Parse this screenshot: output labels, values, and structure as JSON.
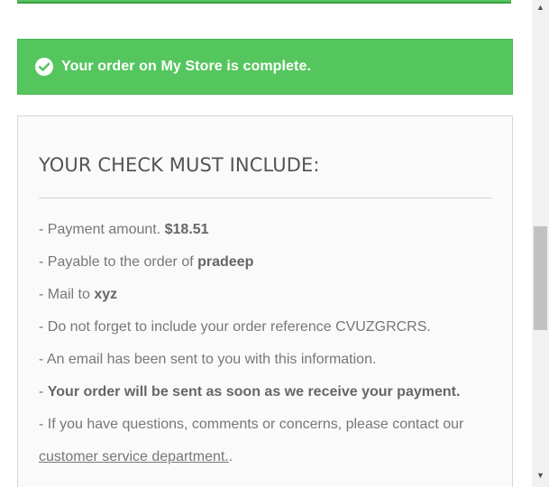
{
  "alert": {
    "message": "Your order on My Store is complete."
  },
  "check": {
    "heading": "YOUR CHECK MUST INCLUDE:",
    "payment_amount_label": "- Payment amount.",
    "payment_amount_value": "$18.51",
    "payable_label": "- Payable to the order of",
    "payable_value": "pradeep",
    "mail_label": "- Mail to",
    "mail_value": "xyz",
    "reference_text": "- Do not forget to include your order reference CVUZGRCRS.",
    "email_text": "- An email has been sent to you with this information.",
    "dash": "- ",
    "shipment_text": "Your order will be sent as soon as we receive your payment.",
    "questions_text": "- If you have questions, comments or concerns, please contact our",
    "service_link": "customer service department.",
    "service_suffix": "."
  },
  "scrollbar": {
    "up_arrow": "▲",
    "down_arrow": "▼"
  },
  "colors": {
    "success_green": "#55c65e",
    "panel_background": "#fafafa",
    "heading_text": "#555454",
    "body_text": "#777777"
  },
  "icons": {
    "success": "check-circle-icon"
  }
}
